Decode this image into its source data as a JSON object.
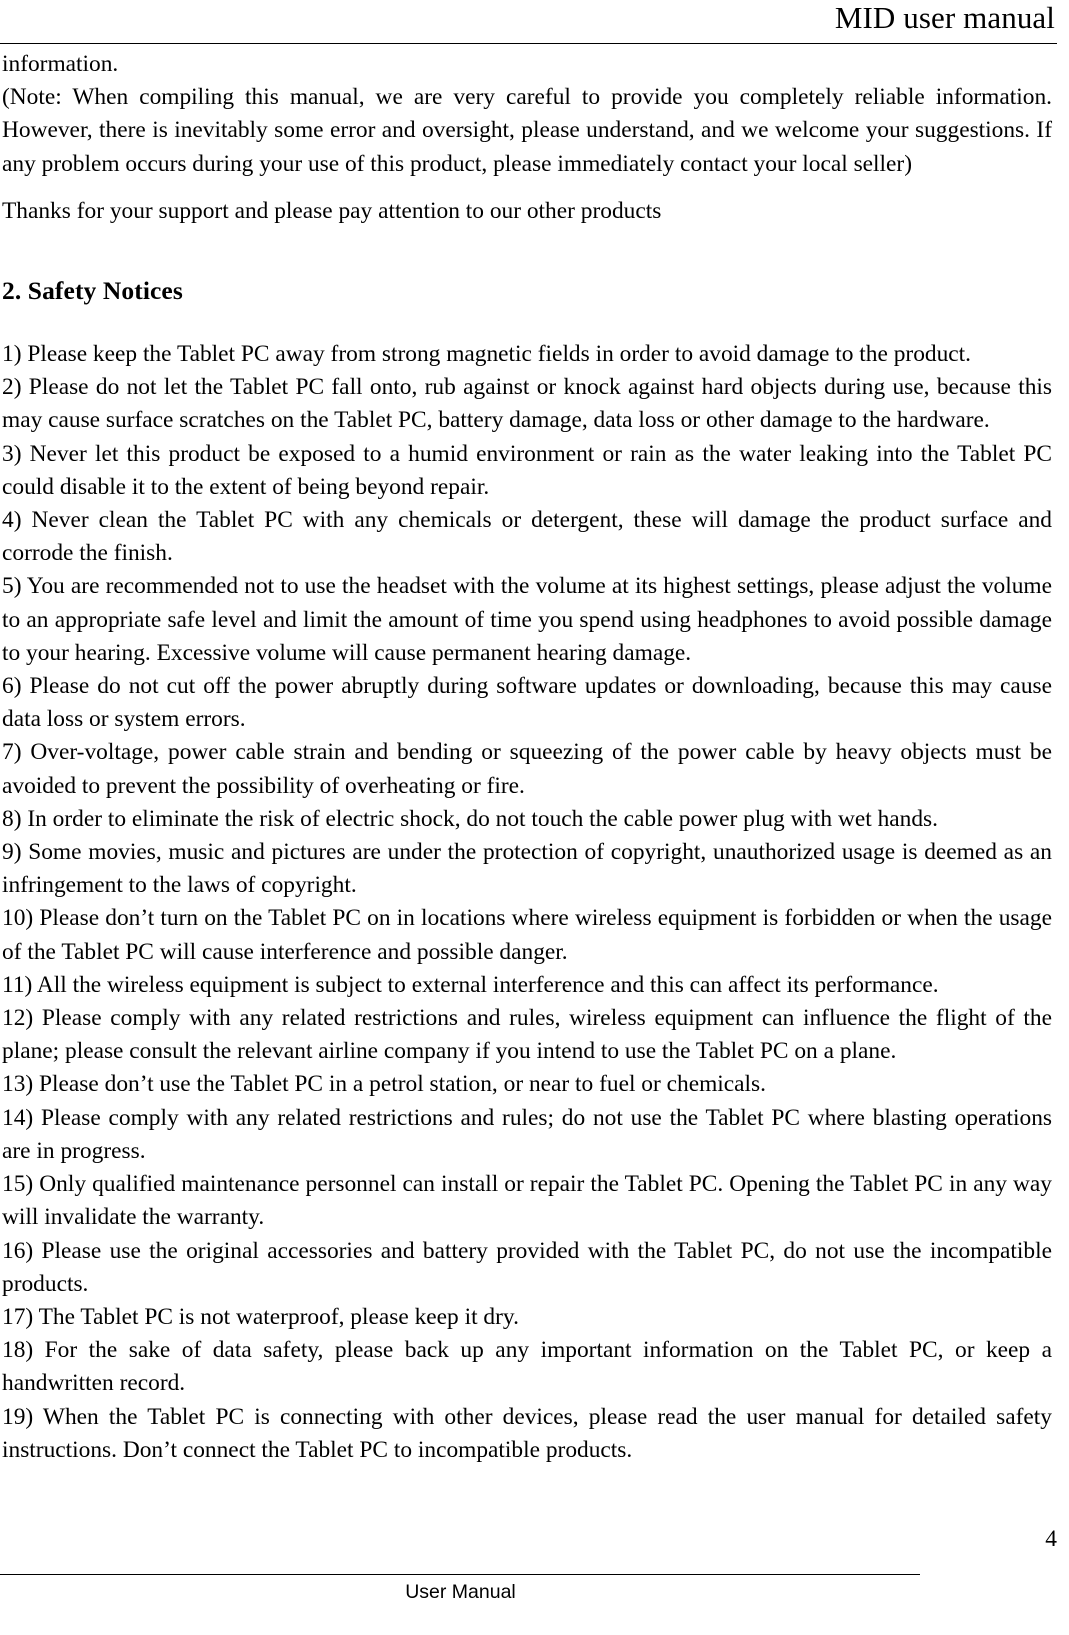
{
  "header": {
    "title": "MID user manual"
  },
  "body": {
    "continued_word": "information.",
    "note_paragraph": "(Note: When compiling this manual, we are very careful to provide you completely reliable information. However, there is inevitably some error and oversight, please understand, and we welcome your suggestions. If any problem occurs during your use of this product, please immediately contact your local seller)",
    "thanks_paragraph": "Thanks for your support and please pay attention to our other products"
  },
  "section": {
    "heading": "2. Safety Notices",
    "notices": [
      "1) Please keep the Tablet PC away from strong magnetic fields in order to avoid damage to the product.",
      "2) Please do not let the Tablet PC fall onto, rub against or knock against hard objects during use, because this may cause surface scratches on the Tablet PC, battery damage, data loss or other damage to the hardware.",
      "3) Never let this product be exposed to a humid environment or rain as the water leaking into the Tablet PC could disable it to the extent of being beyond repair.",
      "4) Never clean the Tablet PC with any chemicals or detergent, these will damage the product surface and corrode the finish.",
      "5) You are recommended not to use the headset with the volume at its highest settings, please adjust the volume to an appropriate safe level and limit the amount of time you spend using headphones to avoid possible damage to your hearing. Excessive volume will cause permanent hearing damage.",
      "6) Please do not cut off the power abruptly during software updates or downloading, because this may cause data loss or system errors.",
      "7) Over-voltage, power cable strain and bending or squeezing of the power cable by heavy objects must be avoided to prevent the possibility of overheating or fire.",
      "8) In order to eliminate the risk of electric shock, do not touch the cable power plug with wet hands.",
      "9) Some movies, music and pictures are under the protection of copyright, unauthorized usage is deemed as an infringement to the laws of copyright.",
      "10) Please don’t turn on the Tablet PC on in locations where wireless equipment is forbidden or when the usage of the Tablet PC will cause interference and possible danger.",
      "11) All the wireless equipment is subject to external interference and this can affect its performance.",
      "12) Please comply with any related restrictions and rules, wireless equipment can influence the flight of the plane; please consult the relevant airline company if you intend to use the Tablet PC on a plane.",
      "13) Please don’t use the Tablet PC in a petrol station, or near to fuel or chemicals.",
      "14) Please comply with any related restrictions and rules; do not use the Tablet PC where blasting operations are in progress.",
      "15) Only qualified maintenance personnel can install or repair the Tablet PC. Opening the Tablet PC in any way will invalidate the warranty.",
      "16) Please use the original accessories and battery provided with the Tablet PC, do not use the incompatible products.",
      "17) The Tablet PC is not waterproof, please keep it dry.",
      "18) For the sake of data safety, please back up any important information on the Tablet PC, or keep a handwritten record.",
      "19) When the Tablet PC is connecting with other devices, please read the user manual for detailed safety instructions. Don’t connect the Tablet PC to incompatible products."
    ]
  },
  "footer": {
    "page_number": "4",
    "label": "User Manual"
  }
}
